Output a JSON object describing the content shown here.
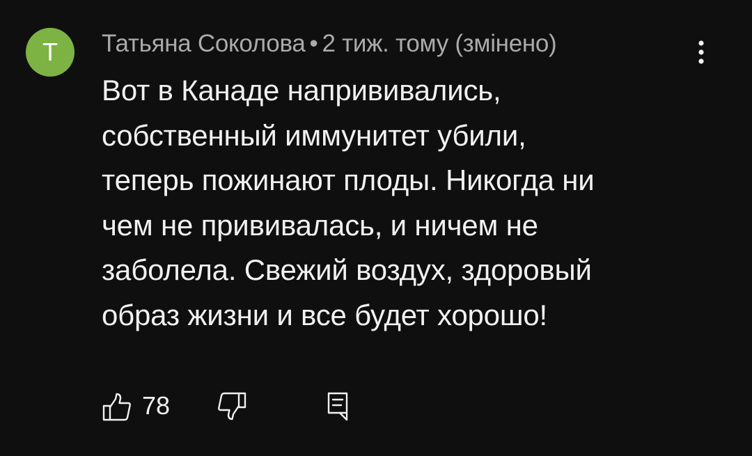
{
  "comment": {
    "avatar_letter": "Т",
    "avatar_color": "#7cb342",
    "author": "Татьяна Соколова",
    "separator": "•",
    "time": "2 тиж. тому",
    "edited": "(змінено)",
    "text_lines": [
      "Вот в Канаде напрививались,",
      "собственный иммунитет убили,",
      "теперь пожинают плоды. Никогда ни",
      "чем не прививалась, и ничем не",
      "заболела. Свежий воздух, здоровый",
      "образ жизни и все будет хорошо!"
    ],
    "like_count": "78"
  },
  "icons": {
    "more": "more-vert-icon",
    "like": "thumbs-up-icon",
    "dislike": "thumbs-down-icon",
    "reply": "reply-comment-icon"
  }
}
